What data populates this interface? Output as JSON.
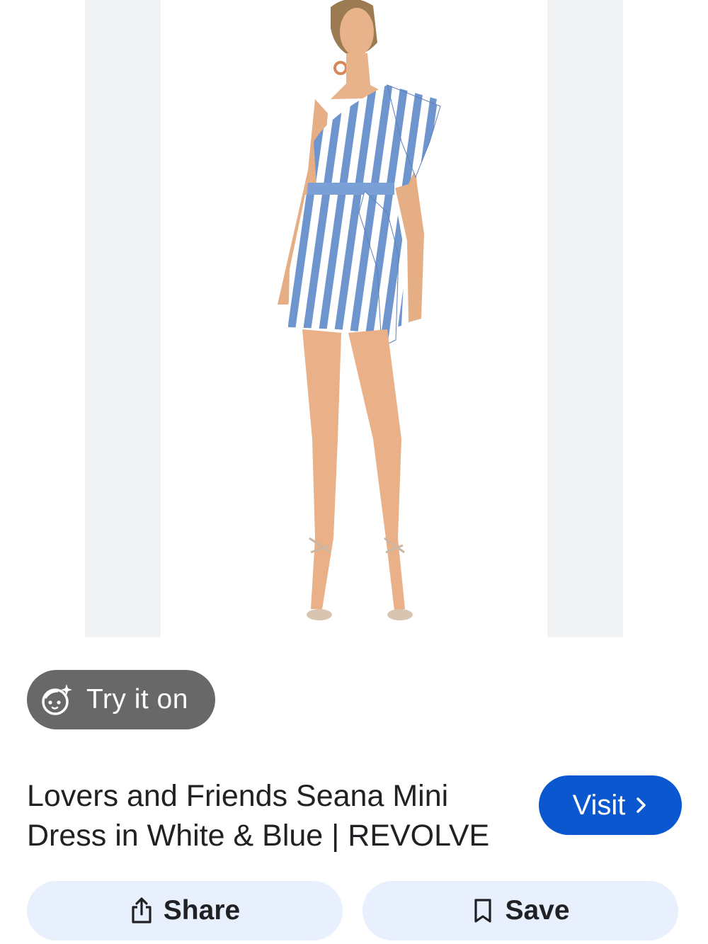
{
  "product_image": {
    "background_color": "#f1f3f4",
    "description_icon": "product-photo"
  },
  "try_on": {
    "label": "Try it on",
    "icon": "face-sparkle-icon"
  },
  "result": {
    "title": "Lovers and Friends Seana Mini Dress in White & Blue | REVOLVE"
  },
  "visit": {
    "label": "Visit",
    "icon": "chevron-right-icon",
    "color": "#0b57d0"
  },
  "actions": {
    "share_label": "Share",
    "share_icon": "share-icon",
    "save_label": "Save",
    "save_icon": "bookmark-icon",
    "background_color": "#e8effd"
  }
}
